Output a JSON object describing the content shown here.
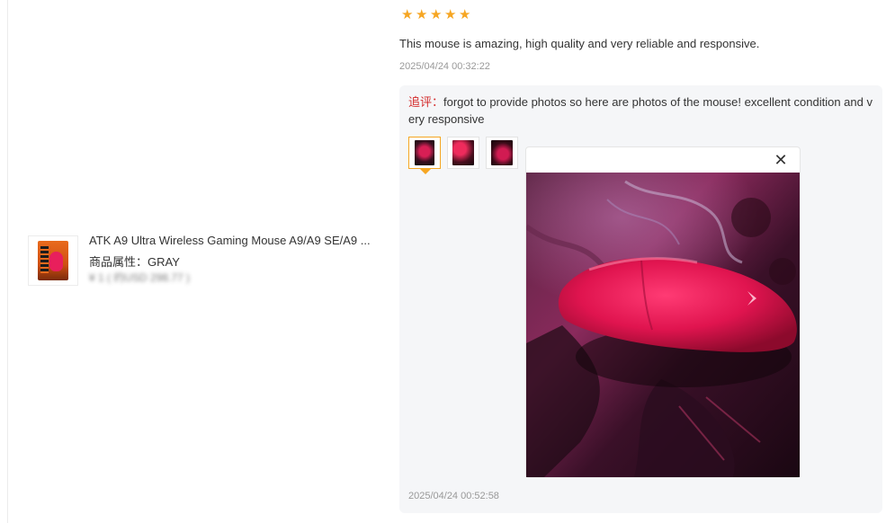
{
  "product": {
    "title": "ATK A9 Ultra Wireless Gaming Mouse A9/A9 SE/A9 ...",
    "attribute": "商品属性：GRAY",
    "price_blurred": "¥ 1 ( 约USD 298.77 )"
  },
  "review": {
    "rating": 5,
    "stars": [
      "★",
      "★",
      "★",
      "★",
      "★"
    ],
    "text": "This mouse is amazing, high quality and very reliable and responsive.",
    "date": "2025/04/24 00:32:22"
  },
  "followup": {
    "prefix": "追评：",
    "text": "forgot to provide photos so here are photos of the mouse! excellent condition and very responsive",
    "thumbnails": [
      "photo-1",
      "photo-2",
      "photo-3"
    ],
    "selected_index": 0,
    "viewer": {
      "close_glyph": "✕"
    },
    "date": "2025/04/24 00:52:58"
  },
  "colors": {
    "star": "#f6a623",
    "followup_prefix": "#d42c2c",
    "mouse": "#e81f5c",
    "panel_bg": "#f5f6f8"
  }
}
